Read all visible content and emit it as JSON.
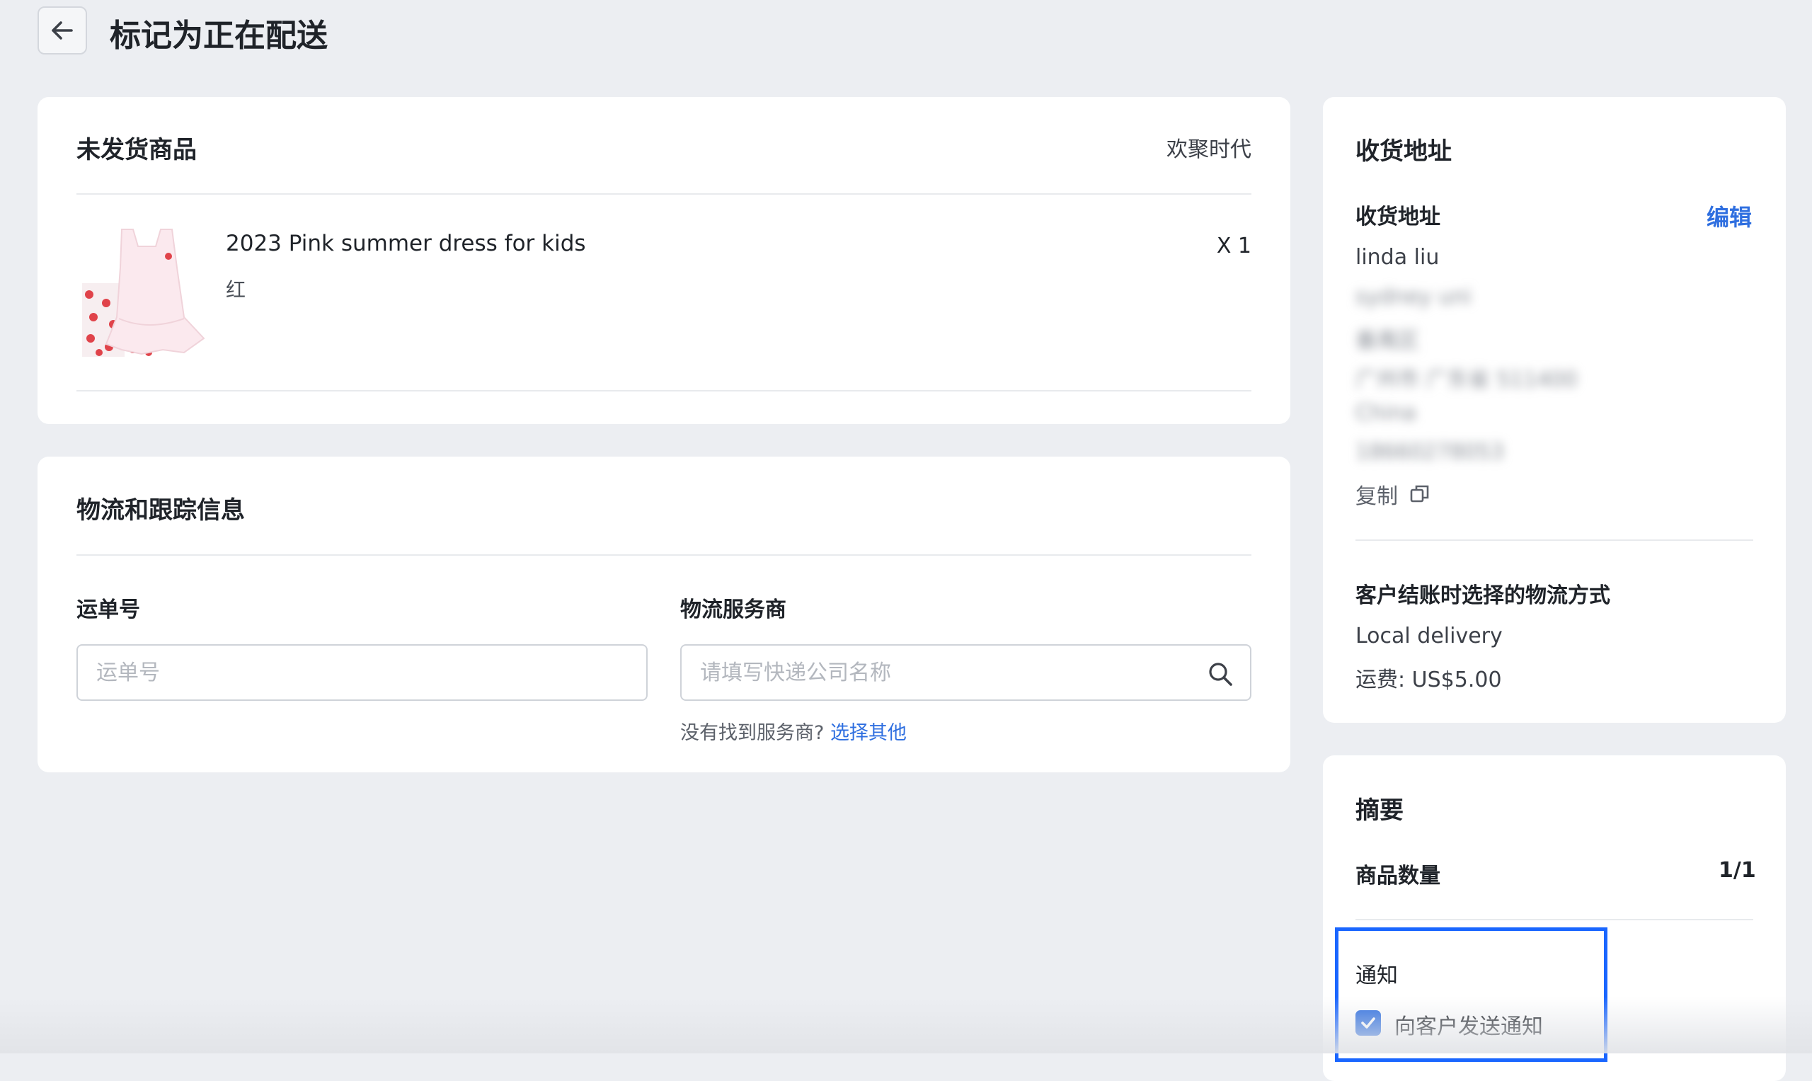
{
  "header": {
    "title": "标记为正在配送"
  },
  "items_card": {
    "title": "未发货商品",
    "store_name": "欢聚时代",
    "product": {
      "name": "2023 Pink summer dress for kids",
      "variant": "红",
      "quantity": "X 1"
    }
  },
  "logistics": {
    "title": "物流和跟踪信息",
    "tracking_label": "运单号",
    "tracking_placeholder": "运单号",
    "carrier_label": "物流服务商",
    "carrier_placeholder": "请填写快递公司名称",
    "hint_text": "没有找到服务商?",
    "hint_link": "选择其他"
  },
  "address_card": {
    "title": "收货地址",
    "subtitle": "收货地址",
    "edit_label": "编辑",
    "name": "linda liu",
    "blurred_lines": [
      "sydney uni",
      "番禺区",
      "广州市 广东省 511400",
      "China",
      "18660278053"
    ],
    "copy_label": "复制",
    "shipping_title": "客户结账时选择的物流方式",
    "shipping_method": "Local delivery",
    "shipping_fee": "运费: US$5.00"
  },
  "summary_card": {
    "title": "摘要",
    "item_count_label": "商品数量",
    "item_count_value": "1/1",
    "notify_title": "通知",
    "notify_checkbox_label": "向客户发送通知",
    "notify_checked": true
  },
  "colors": {
    "accent": "#2f6fe0",
    "highlight_border": "#1a66ff",
    "background": "#eceef2"
  }
}
